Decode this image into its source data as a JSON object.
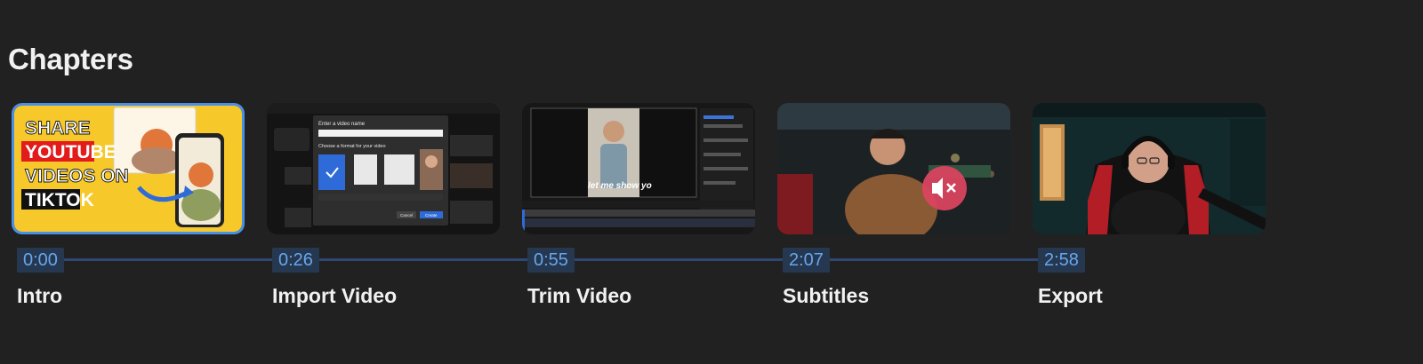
{
  "section": {
    "title": "Chapters"
  },
  "chapters": [
    {
      "time": "0:00",
      "title": "Intro",
      "active": true,
      "thumb_text": [
        "SHARE",
        "YOUTUBE",
        "VIDEOS ON",
        "TIKTOK"
      ]
    },
    {
      "time": "0:26",
      "title": "Import Video",
      "active": false,
      "thumb_text": [
        "Enter a video name",
        "Choose a format for your video",
        "Cancel",
        "Create"
      ]
    },
    {
      "time": "0:55",
      "title": "Trim Video",
      "active": false,
      "thumb_text": [
        "let me show yo"
      ]
    },
    {
      "time": "2:07",
      "title": "Subtitles",
      "active": false,
      "thumb_text": []
    },
    {
      "time": "2:58",
      "title": "Export",
      "active": false,
      "thumb_text": []
    }
  ],
  "colors": {
    "background": "#212121",
    "accent": "#4a8fe6",
    "timestamp_text": "#67a6ee",
    "timestamp_bg": "#263850",
    "timeline": "#2e4873",
    "mute_badge": "#d9455f"
  },
  "icons": {
    "thumbnail_4_overlay": "muted-speaker-icon",
    "thumbnail_2_checkbox": "checkmark-icon"
  }
}
